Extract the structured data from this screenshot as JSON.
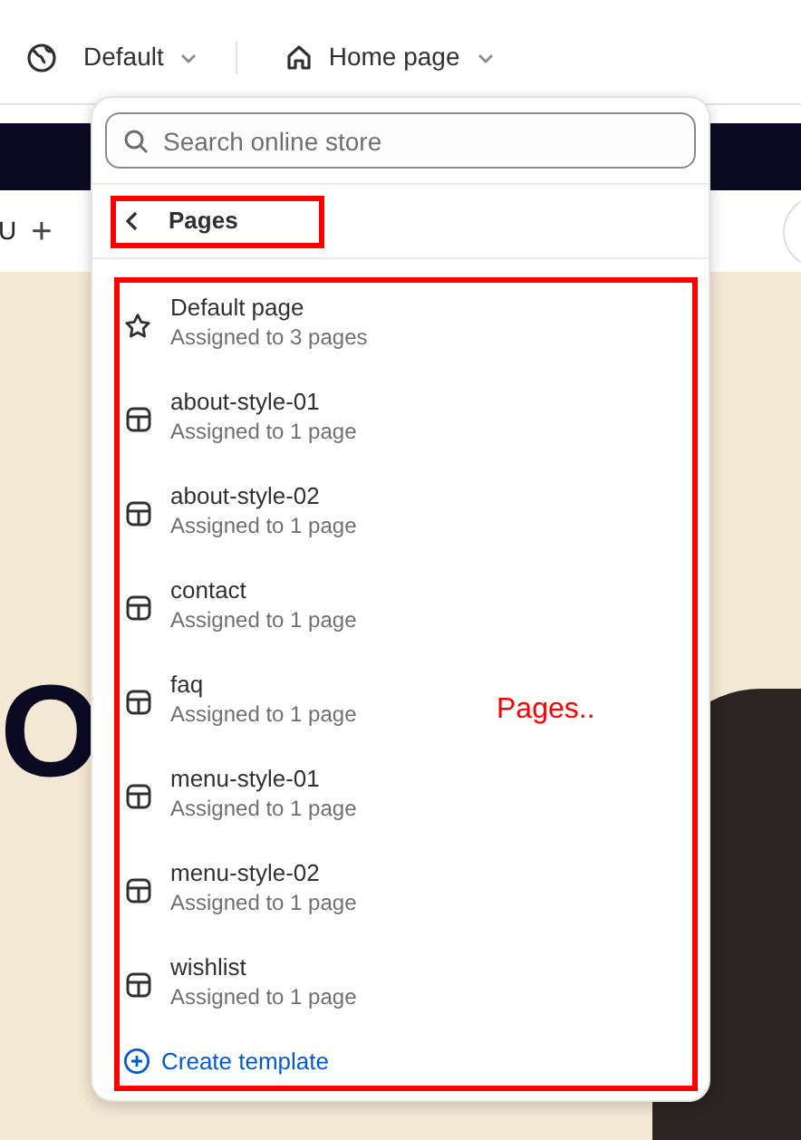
{
  "toolbar": {
    "theme_label": "Default",
    "page_label": "Home page"
  },
  "storefront": {
    "nav_text": "U",
    "nav_plus": "+",
    "hero_letter": "O"
  },
  "popover": {
    "search": {
      "placeholder": "Search online store"
    },
    "back_label": "Pages",
    "templates": [
      {
        "kind": "default",
        "name": "Default page",
        "assigned": "Assigned to 3 pages"
      },
      {
        "kind": "template",
        "name": "about-style-01",
        "assigned": "Assigned to 1 page"
      },
      {
        "kind": "template",
        "name": "about-style-02",
        "assigned": "Assigned to 1 page"
      },
      {
        "kind": "template",
        "name": "contact",
        "assigned": "Assigned to 1 page"
      },
      {
        "kind": "template",
        "name": "faq",
        "assigned": "Assigned to 1 page"
      },
      {
        "kind": "template",
        "name": "menu-style-01",
        "assigned": "Assigned to 1 page"
      },
      {
        "kind": "template",
        "name": "menu-style-02",
        "assigned": "Assigned to 1 page"
      },
      {
        "kind": "template",
        "name": "wishlist",
        "assigned": "Assigned to 1 page"
      }
    ],
    "create_label": "Create template"
  },
  "annotation": {
    "label": "Pages.."
  }
}
